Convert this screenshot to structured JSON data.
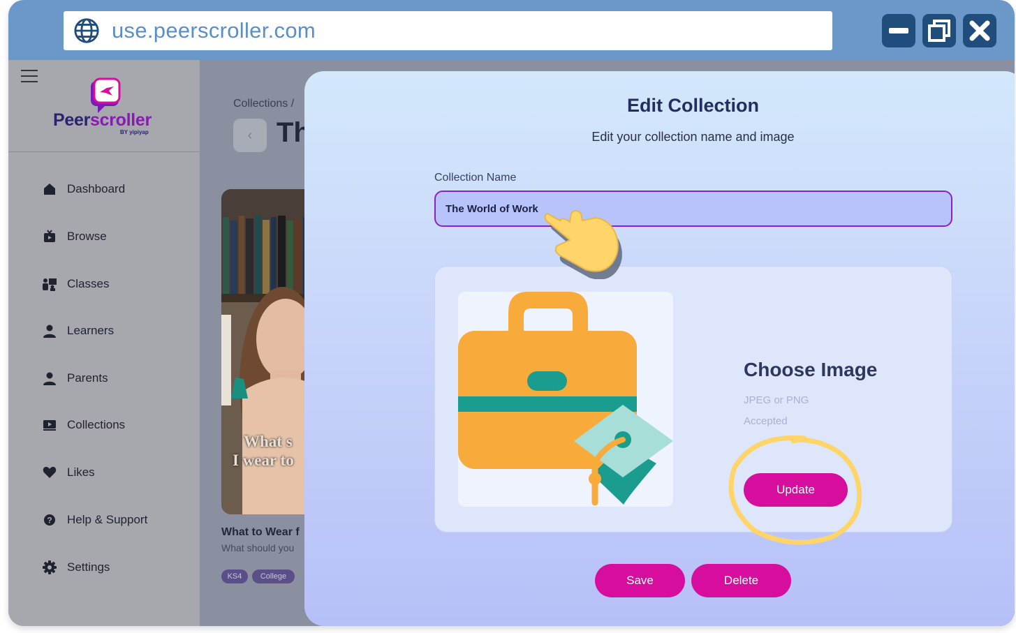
{
  "browser": {
    "url": "use.peerscroller.com"
  },
  "sidebar": {
    "brand": {
      "name_part1": "Peer",
      "name_part2": "scroller",
      "by": "BY yipiyap"
    },
    "items": [
      {
        "label": "Dashboard",
        "icon": "home-icon"
      },
      {
        "label": "Browse",
        "icon": "tv-icon"
      },
      {
        "label": "Classes",
        "icon": "classroom-icon"
      },
      {
        "label": "Learners",
        "icon": "person-icon"
      },
      {
        "label": "Parents",
        "icon": "person-icon"
      },
      {
        "label": "Collections",
        "icon": "collection-icon"
      },
      {
        "label": "Likes",
        "icon": "heart-icon"
      },
      {
        "label": "Help & Support",
        "icon": "help-icon"
      },
      {
        "label": "Settings",
        "icon": "gear-icon"
      }
    ]
  },
  "page": {
    "breadcrumb": "Collections /",
    "title": "Th",
    "card": {
      "overlay_line1": "What s",
      "overlay_line2": "I wear to",
      "title": "What to Wear f",
      "subtitle": "What should you",
      "tags": [
        "KS4",
        "College"
      ]
    }
  },
  "modal": {
    "title": "Edit Collection",
    "subtitle": "Edit your collection name and image",
    "name_label": "Collection Name",
    "name_value": "The World of Work",
    "choose_title": "Choose Image",
    "choose_note_1": "JPEG or PNG",
    "choose_note_2": "Accepted",
    "update_label": "Update",
    "save_label": "Save",
    "delete_label": "Delete"
  },
  "colors": {
    "accent": "#d70d9e",
    "browser_chrome": "#6b98c9",
    "window_buttons": "#1f4d7c",
    "annotation": "#ffd56a"
  }
}
